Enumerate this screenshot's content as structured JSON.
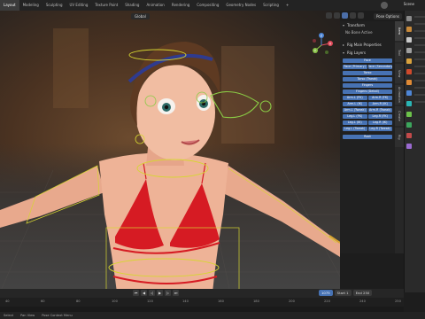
{
  "menu": {
    "tabs": [
      "Layout",
      "Modeling",
      "Sculpting",
      "UV Editing",
      "Texture Paint",
      "Shading",
      "Animation",
      "Rendering",
      "Compositing",
      "Geometry Nodes",
      "Scripting",
      "+"
    ],
    "active_index": 0,
    "scene_label": "Scene"
  },
  "viewport": {
    "mode_label": "Global",
    "pose_options_label": "Pose Options",
    "gizmo_axes": [
      "X",
      "Y",
      "Z"
    ]
  },
  "npanel": {
    "transform_header": "Transform",
    "no_bone_note": "No Bone Active",
    "rig_props_header": "Rig Main Properties",
    "rig_layers_header": "Rig Layers",
    "layers": {
      "face": "Face",
      "face_pair": [
        "Face (Primary)",
        "Face (Secondary)"
      ],
      "torso": "Torso",
      "torso_tweak": "Torso (Tweak)",
      "fingers": "Fingers",
      "fingers_detail": "Fingers (Detail)",
      "arm_fk": [
        "Arm.L (FK)",
        "Arm.R (FK)"
      ],
      "arm_ik": [
        "Arm.L (IK)",
        "Arm.R (IK)"
      ],
      "arm_tweak": [
        "Arm.L (Tweak)",
        "Arm.R (Tweak)"
      ],
      "leg_fk": [
        "Leg.L (FK)",
        "Leg.R (FK)"
      ],
      "leg_ik": [
        "Leg.L (IK)",
        "Leg.R (IK)"
      ],
      "leg_tweak": [
        "Leg.L (Tweak)",
        "Leg.R (Tweak)"
      ],
      "root": "Root"
    },
    "tabs": [
      "Item",
      "Tool",
      "View",
      "Animation",
      "Create",
      "Rig"
    ],
    "active_tab": "Item"
  },
  "timeline": {
    "current_frame": "1075",
    "start_label": "Start",
    "start_value": "1",
    "end_label": "End",
    "end_value": "250",
    "ruler": [
      "40",
      "60",
      "80",
      "100",
      "120",
      "140",
      "160",
      "180",
      "200",
      "220",
      "240",
      "250"
    ]
  },
  "statusbar": {
    "items": [
      "Select",
      "Pan View",
      "Pose Context Menu"
    ]
  },
  "colors": {
    "accent": "#4772b3",
    "bone_yellow": "#d6d631",
    "bone_green": "#8acb45",
    "bikini_red": "#d61b23"
  }
}
